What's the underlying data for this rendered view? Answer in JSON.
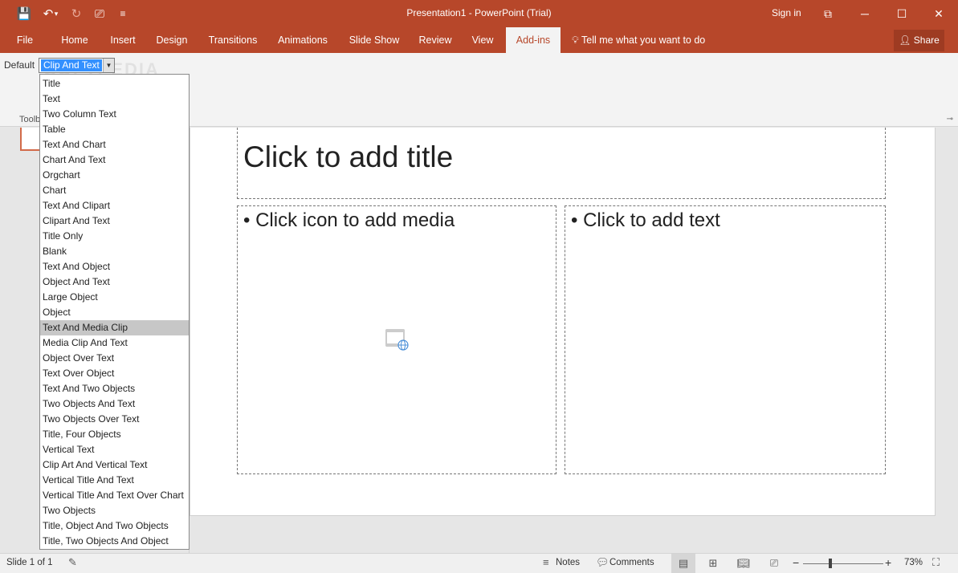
{
  "titlebar": {
    "doc_title": "Presentation1 - PowerPoint (Trial)",
    "sign_in": "Sign in",
    "icons": [
      "save-icon",
      "undo-icon",
      "redo-icon",
      "start-from-beginning-icon",
      "customize-qat-icon",
      "ribbon-display-options-icon",
      "minimize-icon",
      "maximize-icon",
      "close-icon"
    ],
    "qa_glyphs": {
      "save": "💾",
      "undo": "↶",
      "undo_more": "▾",
      "redo": "↻",
      "present": "⎚",
      "customize": "≡"
    },
    "win_glyphs": {
      "ribbon_opts": "⧉",
      "minimize": "─",
      "maximize": "☐",
      "close": "✕"
    }
  },
  "tabs": [
    {
      "label": "File"
    },
    {
      "label": "Home"
    },
    {
      "label": "Insert"
    },
    {
      "label": "Design"
    },
    {
      "label": "Transitions"
    },
    {
      "label": "Animations"
    },
    {
      "label": "Slide Show"
    },
    {
      "label": "Review"
    },
    {
      "label": "View"
    },
    {
      "label": "Add-ins",
      "active": true
    }
  ],
  "tell_me": "Tell me what you want to do",
  "share_label": "Share",
  "ribbon": {
    "default_label": "Default",
    "layout_value": "Clip And Text",
    "group_label": "Toolb",
    "watermark": "SOFTPEDIA"
  },
  "dropdown_options": [
    "Title",
    "Text",
    "Two Column Text",
    "Table",
    "Text And Chart",
    "Chart And Text",
    "Orgchart",
    "Chart",
    "Text And Clipart",
    "Clipart And Text",
    "Title Only",
    "Blank",
    "Text And Object",
    "Object And Text",
    "Large Object",
    "Object",
    "Text And Media Clip",
    "Media Clip And Text",
    "Object Over Text",
    "Text Over Object",
    "Text And Two Objects",
    "Two Objects And Text",
    "Two Objects Over Text",
    "Title, Four Objects",
    "Vertical Text",
    "Clip Art And Vertical Text",
    "Vertical Title And Text",
    "Vertical Title And Text Over Chart",
    "Two Objects",
    "Title, Object And Two Objects",
    "Title, Two Objects And Object"
  ],
  "dropdown_selected": "Text And Media Clip",
  "slide": {
    "title_placeholder": "Click to add title",
    "left_placeholder": "• Click icon to add media",
    "right_placeholder": "• Click to add text"
  },
  "statusbar": {
    "slide_info": "Slide 1 of 1",
    "notes": "Notes",
    "comments": "Comments",
    "zoom": "73%"
  },
  "colors": {
    "accent": "#b7472a",
    "ribbon_bg": "#f3f3f3",
    "selection": "#3390ff"
  }
}
